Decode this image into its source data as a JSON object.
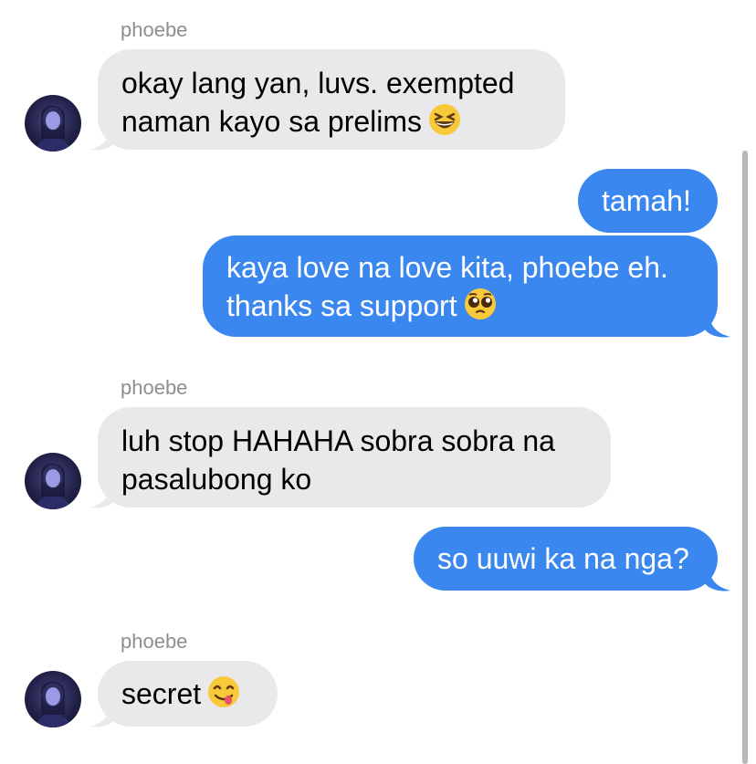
{
  "thread": {
    "messages": [
      {
        "id": "m1",
        "direction": "incoming",
        "sender": "phoebe",
        "lines": [
          "okay lang yan, luvs. exempted",
          "naman kayo sa prelims"
        ],
        "emoji": "grinning-squinting-face"
      },
      {
        "id": "m2",
        "direction": "outgoing",
        "lines": [
          "tamah!"
        ]
      },
      {
        "id": "m3",
        "direction": "outgoing",
        "lines": [
          "kaya love na love kita, phoebe eh.",
          "thanks sa support"
        ],
        "emoji": "pleading-face"
      },
      {
        "id": "m4",
        "direction": "incoming",
        "sender": "phoebe",
        "lines": [
          "luh stop HAHAHA sobra sobra na",
          "pasalubong ko"
        ]
      },
      {
        "id": "m5",
        "direction": "outgoing",
        "lines": [
          "so uuwi ka na nga?"
        ]
      },
      {
        "id": "m6",
        "direction": "incoming",
        "sender": "phoebe",
        "lines": [
          "secret"
        ],
        "emoji": "face-savoring-food"
      }
    ]
  },
  "colors": {
    "incoming_bubble": "#e9e9eb",
    "outgoing_bubble": "#3a87f0",
    "sender_label": "#8e8e93"
  }
}
